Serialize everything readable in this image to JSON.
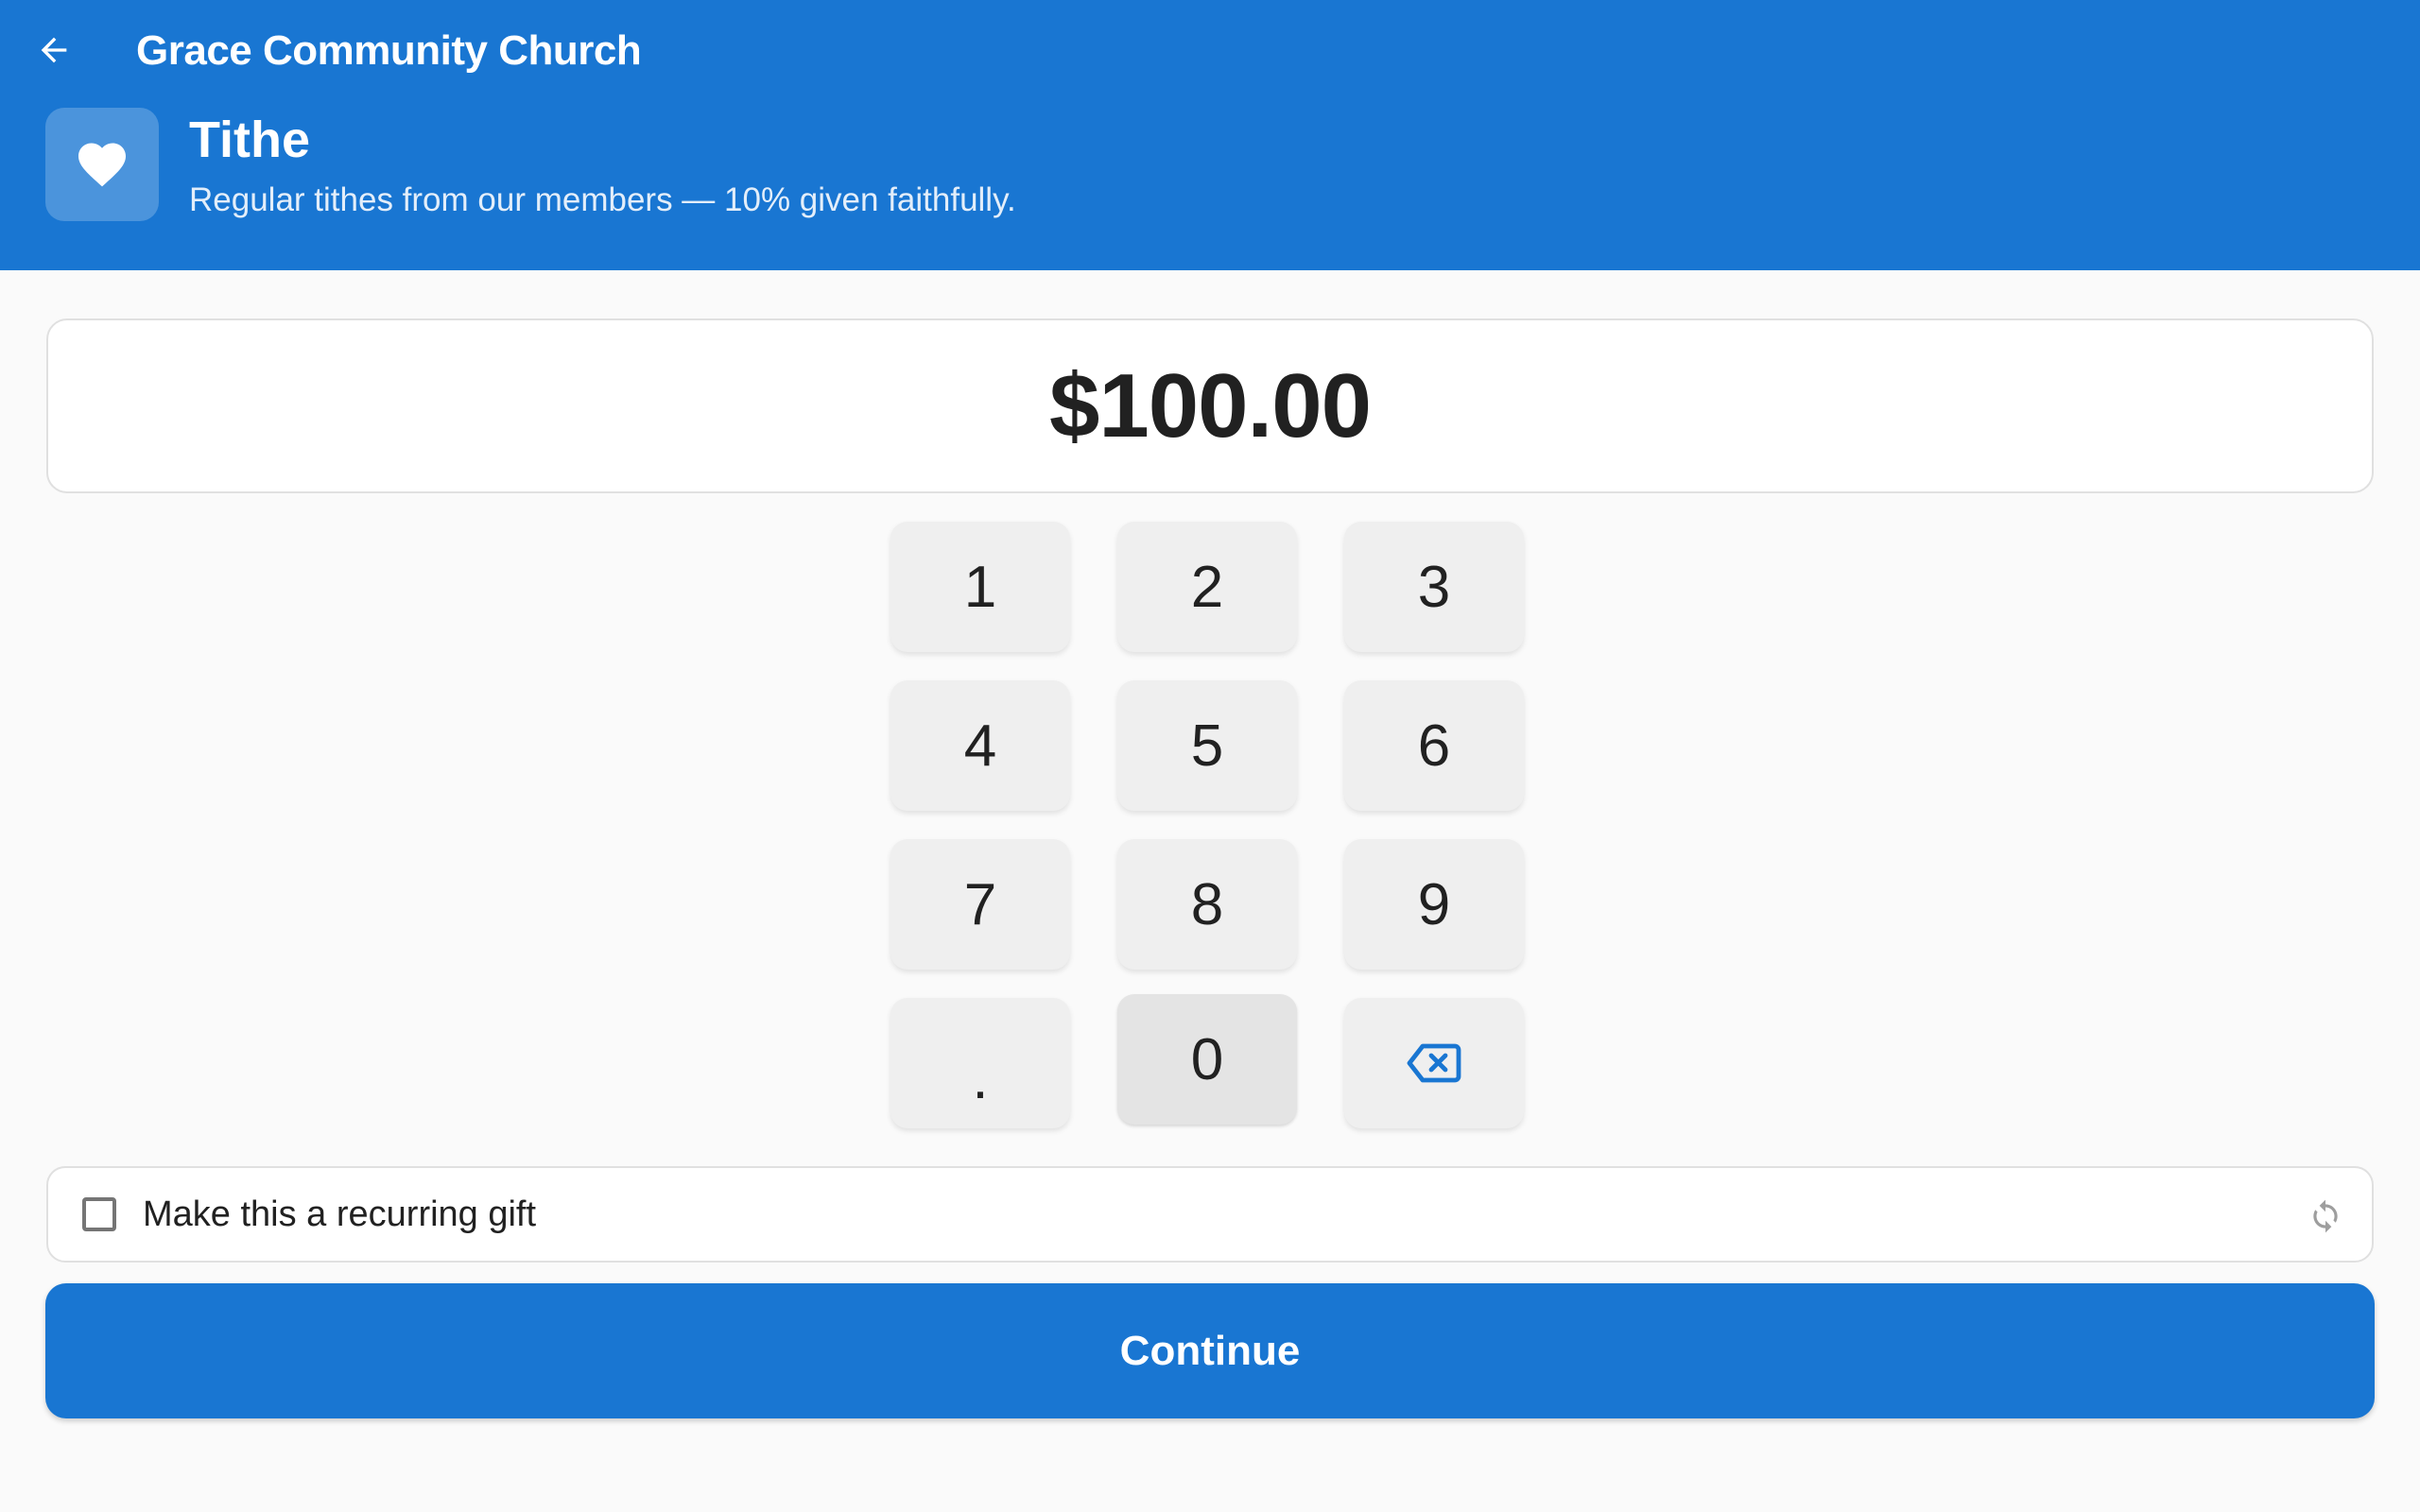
{
  "colors": {
    "primary": "#1976d2",
    "background": "#fafafa",
    "key_background": "#efefef",
    "text": "#212121"
  },
  "header": {
    "back_icon": "arrow-left-icon",
    "title": "Grace Community Church"
  },
  "fund": {
    "icon": "heart-icon",
    "name": "Tithe",
    "description": "Regular tithes from our members — 10% given faithfully."
  },
  "amount": {
    "display": "$100.00"
  },
  "keypad": {
    "keys": [
      "1",
      "2",
      "3",
      "4",
      "5",
      "6",
      "7",
      "8",
      "9",
      ".",
      "0"
    ],
    "backspace_icon": "backspace-icon"
  },
  "recurring": {
    "label": "Make this a recurring gift",
    "checked": false,
    "icon": "refresh-icon"
  },
  "continue": {
    "label": "Continue"
  }
}
